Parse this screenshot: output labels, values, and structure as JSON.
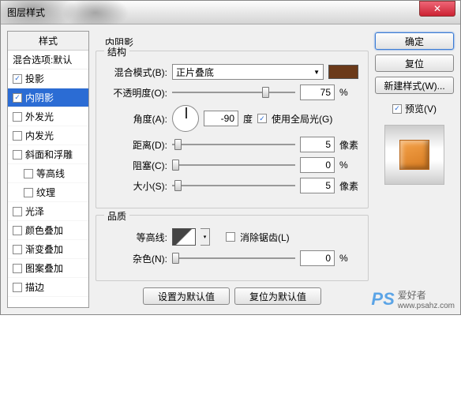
{
  "window": {
    "title": "图层样式",
    "close": "✕"
  },
  "sidebar": {
    "header": "样式",
    "sub": "混合选项:默认",
    "items": [
      {
        "label": "投影",
        "checked": true,
        "selected": false
      },
      {
        "label": "内阴影",
        "checked": true,
        "selected": true
      },
      {
        "label": "外发光",
        "checked": false,
        "selected": false
      },
      {
        "label": "内发光",
        "checked": false,
        "selected": false
      },
      {
        "label": "斜面和浮雕",
        "checked": false,
        "selected": false
      },
      {
        "label": "等高线",
        "checked": false,
        "selected": false,
        "indent": true
      },
      {
        "label": "纹理",
        "checked": false,
        "selected": false,
        "indent": true
      },
      {
        "label": "光泽",
        "checked": false,
        "selected": false
      },
      {
        "label": "颜色叠加",
        "checked": false,
        "selected": false
      },
      {
        "label": "渐变叠加",
        "checked": false,
        "selected": false
      },
      {
        "label": "图案叠加",
        "checked": false,
        "selected": false
      },
      {
        "label": "描边",
        "checked": false,
        "selected": false
      }
    ]
  },
  "center": {
    "title": "内阴影",
    "structure": {
      "legend": "结构",
      "blend_label": "混合模式(B):",
      "blend_value": "正片叠底",
      "color": "#6b3a1a",
      "opacity_label": "不透明度(O):",
      "opacity_value": "75",
      "opacity_unit": "%",
      "angle_label": "角度(A):",
      "angle_value": "-90",
      "angle_unit": "度",
      "global_light": "使用全局光(G)",
      "distance_label": "距离(D):",
      "distance_value": "5",
      "distance_unit": "像素",
      "choke_label": "阻塞(C):",
      "choke_value": "0",
      "choke_unit": "%",
      "size_label": "大小(S):",
      "size_value": "5",
      "size_unit": "像素"
    },
    "quality": {
      "legend": "品质",
      "contour_label": "等高线:",
      "antialias": "消除锯齿(L)",
      "noise_label": "杂色(N):",
      "noise_value": "0",
      "noise_unit": "%"
    },
    "defaults_set": "设置为默认值",
    "defaults_reset": "复位为默认值"
  },
  "right": {
    "ok": "确定",
    "cancel": "复位",
    "new_style": "新建样式(W)...",
    "preview_label": "预览(V)"
  },
  "watermark": {
    "brand": "PS",
    "text": "爱好者",
    "url": "www.psahz.com"
  }
}
